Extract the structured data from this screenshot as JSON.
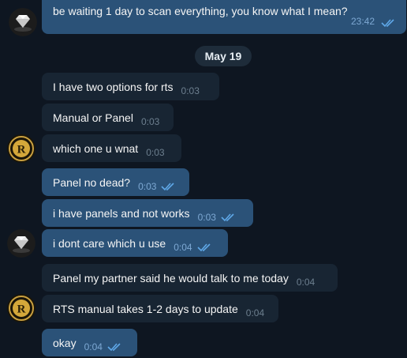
{
  "date_separator": "May 19",
  "messages": [
    {
      "text": "be waiting 1 day to scan everything, you know what I mean?",
      "time": "23:42",
      "direction": "out"
    },
    {
      "text": "I have two options for rts",
      "time": "0:03",
      "direction": "in"
    },
    {
      "text": "Manual or Panel",
      "time": "0:03",
      "direction": "in"
    },
    {
      "text": "which one u wnat",
      "time": "0:03",
      "direction": "in"
    },
    {
      "text": "Panel no dead?",
      "time": "0:03",
      "direction": "out"
    },
    {
      "text": "i have panels and not works",
      "time": "0:03",
      "direction": "out"
    },
    {
      "text": "i dont care which u use",
      "time": "0:04",
      "direction": "out"
    },
    {
      "text": "Panel my partner said he would talk to me today",
      "time": "0:04",
      "direction": "in"
    },
    {
      "text": "RTS manual takes 1-2 days to update",
      "time": "0:04",
      "direction": "in"
    },
    {
      "text": "okay",
      "time": "0:04",
      "direction": "out"
    }
  ],
  "avatars": [
    {
      "name": "diamond-avatar",
      "icon": "diamond-icon"
    },
    {
      "name": "bitcoin-avatar",
      "icon": "bitcoin-icon",
      "letter": "R"
    }
  ],
  "colors": {
    "background": "#0e1621",
    "incoming_bubble": "#182533",
    "outgoing_bubble": "#2b5278",
    "read_check": "#5fa8e8"
  }
}
